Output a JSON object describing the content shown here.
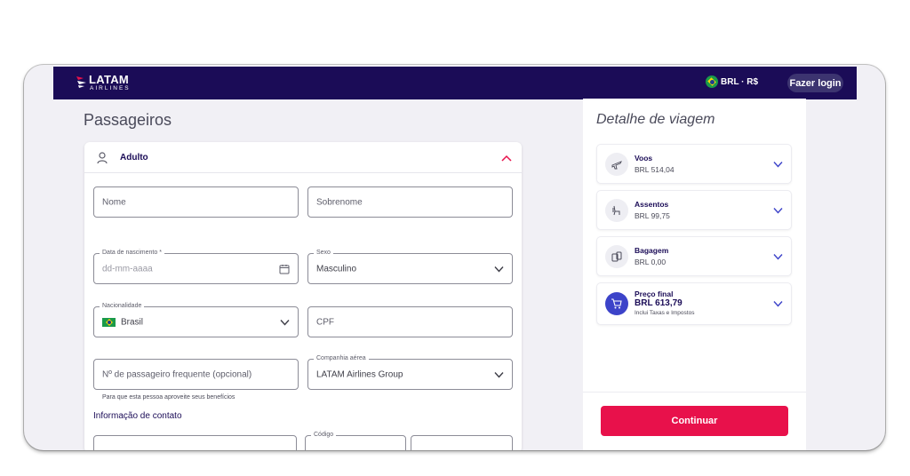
{
  "header": {
    "logo_text": "LATAM",
    "logo_sub": "AIRLINES",
    "currency_label": "BRL · R$",
    "login_label": "Fazer login"
  },
  "passengers": {
    "title": "Passageiros",
    "section_label": "Adulto",
    "fields": {
      "first_name_placeholder": "Nome",
      "last_name_placeholder": "Sobrenome",
      "birthdate_label": "Data de nascimento *",
      "birthdate_placeholder": "dd-mm-aaaa",
      "sex_label": "Sexo",
      "sex_value": "Masculino",
      "nationality_label": "Nacionalidade",
      "nationality_value": "Brasil",
      "cpf_placeholder": "CPF",
      "frequent_placeholder": "Nº de passageiro frequente (opcional)",
      "frequent_hint": "Para que esta pessoa aproveite seus benefícios",
      "airline_label": "Companhia aérea",
      "airline_value": "LATAM Airlines Group",
      "code_label": "Código"
    },
    "contact_title": "Informação de contato"
  },
  "trip": {
    "title": "Detalhe de viagem",
    "items": [
      {
        "title": "Voos",
        "value": "BRL 514,04",
        "icon": "plane-icon"
      },
      {
        "title": "Assentos",
        "value": "BRL 99,75",
        "icon": "seat-icon"
      },
      {
        "title": "Bagagem",
        "value": "BRL 0,00",
        "icon": "luggage-icon"
      }
    ],
    "final": {
      "title": "Preço final",
      "value": "BRL 613,79",
      "note": "Inclui Taxas e Impostos",
      "icon": "cart-icon"
    },
    "continue_label": "Continuar"
  },
  "colors": {
    "brand_navy": "#1b0c57",
    "accent_red": "#e8114b",
    "final_icon_blue": "#3c43c9"
  }
}
